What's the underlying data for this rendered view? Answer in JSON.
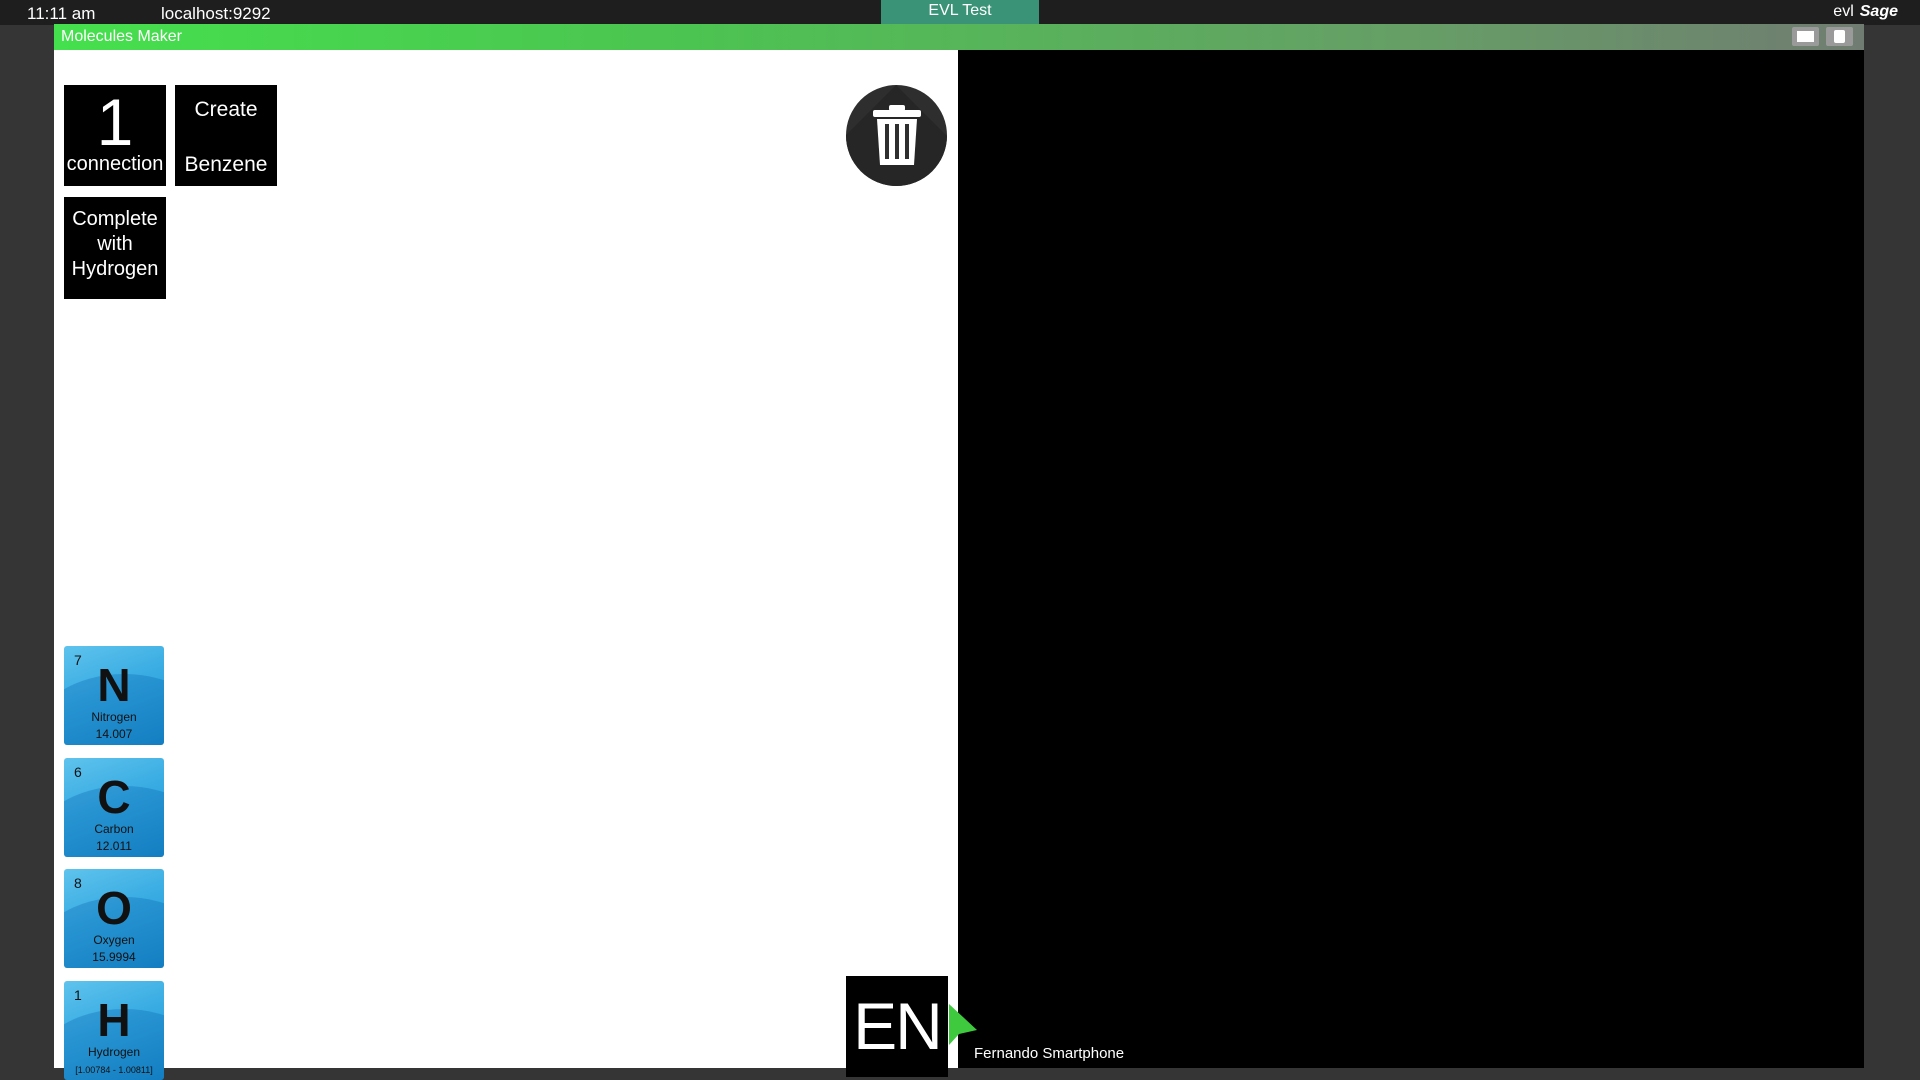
{
  "topbar": {
    "time": "11:11 am",
    "host": "localhost:9292",
    "session": "EVL Test",
    "logo_evl": "evl",
    "logo_sage": "Sage"
  },
  "window": {
    "title": "Molecules Maker"
  },
  "controls": {
    "connection_count": "1",
    "connection_label": "connection",
    "create_line1": "Create",
    "create_line2": "Benzene",
    "complete_line1": "Complete",
    "complete_line2": "with",
    "complete_line3": "Hydrogen"
  },
  "elements": [
    {
      "number": "7",
      "symbol": "N",
      "name": "Nitrogen",
      "mass": "14.007"
    },
    {
      "number": "6",
      "symbol": "C",
      "name": "Carbon",
      "mass": "12.011"
    },
    {
      "number": "8",
      "symbol": "O",
      "name": "Oxygen",
      "mass": "15.9994"
    },
    {
      "number": "1",
      "symbol": "H",
      "name": "Hydrogen",
      "mass": "[1.00784 - 1.00811]"
    }
  ],
  "language": "EN",
  "pointer": {
    "user": "Fernando Smartphone",
    "color": "#3ec93e"
  },
  "colors": {
    "titlebar_accent": "#45e04d",
    "session_tab": "#3b9377",
    "element_tile": "#37abe2"
  }
}
